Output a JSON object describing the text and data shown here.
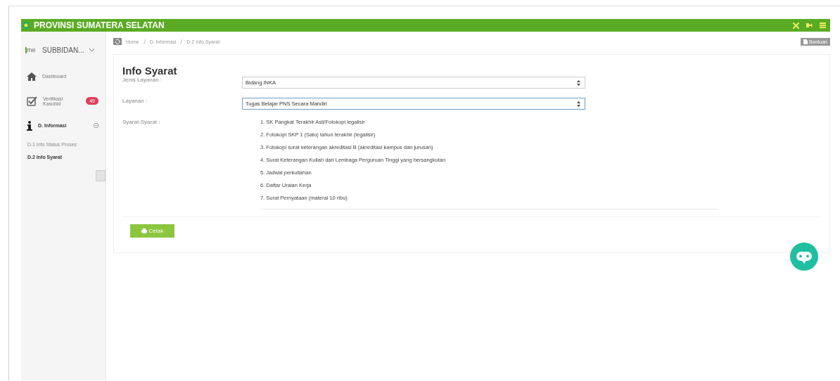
{
  "header": {
    "title": "PROVINSI SUMATERA SELATAN"
  },
  "user": {
    "avatar_alt": "me",
    "name": "SUBBIDAN..."
  },
  "sidebar": {
    "items": [
      {
        "label": "Dashboard",
        "kind": "home"
      },
      {
        "label": "Verifikasi Kasubid",
        "kind": "check",
        "badge": "49"
      },
      {
        "label": "D. Informasi",
        "kind": "info",
        "expanded": true,
        "children": [
          {
            "label": "D.1 Info Status Proses",
            "selected": false
          },
          {
            "label": "D.2 Info Syarat",
            "selected": true
          }
        ]
      }
    ]
  },
  "breadcrumb": [
    "Home",
    "D. Informasi",
    "D.2 Info Syarat"
  ],
  "help_button": "Bantuan",
  "page_title": "Info Syarat",
  "fields": [
    {
      "label": "Jenis Layanan :",
      "value": "Bidang INKA",
      "focused": false
    },
    {
      "label": "Layanan :",
      "value": "Tugas Belajar PNS Secara Mandiri",
      "focused": true
    }
  ],
  "requirements": {
    "label": "Syarat-Syarat :",
    "items": [
      "1. SK Pangkat Terakhir Asli/Fotokopi legalisir",
      "2. Fotokopi SKP 1 (Satu) tahun terakhir (legalisir)",
      "3. Fotokopi surat keterangan akreditasi B (akreditasi kampus dan jurusan)",
      "4. Surat Keterangan Kuliah dari Lembaga Perguruan Tinggi yang bersangkutan",
      "5. Jadwal perkuliahan",
      "6. Daftar Uraian Kerja",
      "7. Surat Pernyataan (materai 10 ribu)"
    ]
  },
  "print_button": "Cetak"
}
